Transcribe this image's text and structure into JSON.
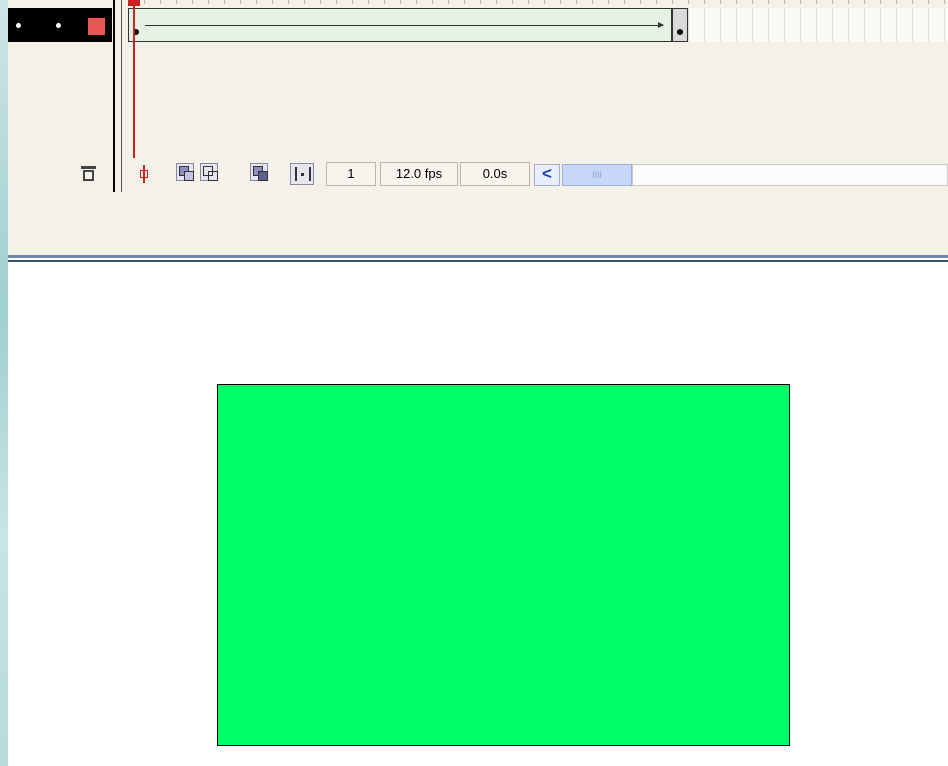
{
  "timeline": {
    "layer": {
      "color": "#ee5555",
      "selected": true
    },
    "tween": {
      "type": "motion",
      "fill_color": "#e4f2e2"
    },
    "playhead_color": "#cc2222"
  },
  "toolbar": {
    "delete_icon": "trash-icon",
    "onion_icons": [
      "center-frame-icon",
      "onion-skin-icon",
      "onion-skin-outlines-icon",
      "edit-multiple-frames-icon",
      "modify-markers-icon"
    ],
    "current_frame": "1",
    "frame_rate": "12.0 fps",
    "elapsed_time": "0.0s",
    "scroll_left_glyph": "<",
    "scroll_thumb_grip": "IIII"
  },
  "stage": {
    "shape": {
      "type": "rectangle",
      "fill": "#00ff66",
      "stroke": "#000000"
    }
  }
}
